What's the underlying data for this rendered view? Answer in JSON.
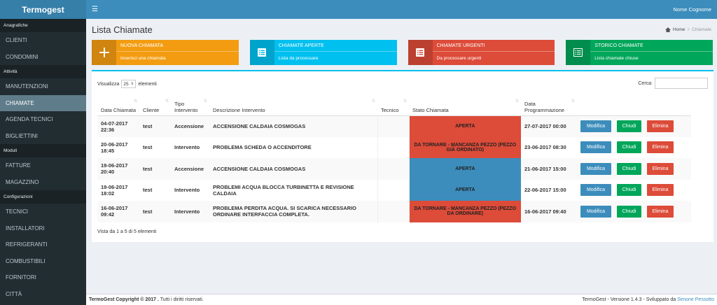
{
  "app": {
    "logo": "Termogest",
    "user": "Nome Cognome"
  },
  "sidebar": {
    "sections": [
      {
        "header": "Anagrafiche",
        "items": [
          "CLIENTI",
          "CONDOMINI"
        ]
      },
      {
        "header": "Attività",
        "items": [
          "MANUTENZIONI",
          "CHIAMATE",
          "AGENDA TECNICI",
          "BIGLIETTINI"
        ]
      },
      {
        "header": "Moduli",
        "items": [
          "FATTURE",
          "MAGAZZINO"
        ]
      },
      {
        "header": "Configurazioni",
        "items": [
          "TECNICI",
          "INSTALLATORI",
          "REFRIGERANTI",
          "COMBUSTIBILI",
          "FORNITORI",
          "CITTÀ"
        ]
      }
    ],
    "active": "CHIAMATE"
  },
  "page": {
    "title": "Lista Chiamate",
    "breadcrumb": {
      "home": "Home",
      "current": "Chiamate"
    }
  },
  "info_boxes": [
    {
      "title": "NUOVA CHIAMATA",
      "subtitle": "Inserisci una chiamata",
      "icon": "plus-icon",
      "color": "#f39c12"
    },
    {
      "title": "CHIAMATE APERTE",
      "subtitle": "Lista da processare",
      "icon": "list-icon",
      "color": "#00c0ef"
    },
    {
      "title": "CHIAMATE URGENTI",
      "subtitle": "Da processare urgenti",
      "icon": "list-icon",
      "color": "#dd4b39"
    },
    {
      "title": "STORICO CHIAMATE",
      "subtitle": "Lista chiamate chiuse",
      "icon": "list-alt-icon",
      "color": "#00a65a"
    }
  ],
  "table_controls": {
    "show_prefix": "Visualizza",
    "page_length": "25",
    "show_suffix": "elementi",
    "search_label": "Cerca:",
    "search_value": ""
  },
  "table": {
    "columns": [
      "Data Chiamata",
      "Cliente",
      "Tipo Intervento",
      "Descrizione Intervento",
      "Tecnico",
      "Stato Chiamata",
      "Data Programmazione",
      ""
    ],
    "rows": [
      {
        "data": "04-07-2017 22:36",
        "cliente": "test",
        "tipo": "Accensione",
        "descrizione": "ACCENSIONE CALDAIA COSMOGAS",
        "tecnico": "",
        "stato": "APERTA",
        "stato_color": "#dd4b39",
        "programmazione": "27-07-2017 00:00"
      },
      {
        "data": "20-06-2017 18:45",
        "cliente": "test",
        "tipo": "Intervento",
        "descrizione": "PROBLEMA SCHEDA O ACCENDITORE",
        "tecnico": "",
        "stato": "DA TORNARE - MANCANZA PEZZO (PEZZO GIÀ ORDINATO)",
        "stato_color": "#dd4b39",
        "programmazione": "23-06-2017 08:30"
      },
      {
        "data": "19-06-2017 20:40",
        "cliente": "test",
        "tipo": "Accensione",
        "descrizione": "ACCENSIONE CALDAIA COSMOGAS",
        "tecnico": "",
        "stato": "APERTA",
        "stato_color": "#3c8dbc",
        "programmazione": "21-06-2017 15:00"
      },
      {
        "data": "19-06-2017 18:02",
        "cliente": "test",
        "tipo": "Intervento",
        "descrizione": "PROBLEMI ACQUA BLOCCA TURBINETTA E REVISIONE CALDAIA",
        "tecnico": "",
        "stato": "APERTA",
        "stato_color": "#3c8dbc",
        "programmazione": "22-06-2017 15:00"
      },
      {
        "data": "16-06-2017 09:42",
        "cliente": "test",
        "tipo": "Intervento",
        "descrizione": "PROBLEMA PERDITA ACQUA. SI SCARICA NECESSARIO ORDINARE INTERFACCIA COMPLETA.",
        "tecnico": "",
        "stato": "DA TORNARE - MANCANZA PEZZO (PEZZO DA ORDINARE)",
        "stato_color": "#dd4b39",
        "programmazione": "16-06-2017 09:40"
      }
    ],
    "actions": {
      "edit": "Modifica",
      "close": "Chiudi",
      "delete": "Elimina"
    },
    "info": "Vista da 1 a 5 di 5 elementi"
  },
  "footer": {
    "copyright": "TermoGest Copyright © 2017 .",
    "rights": "Tutti i diritti riservati.",
    "version": "TermoGest - Versione 1.4.3 - Sviluppato da",
    "author": "Simone Pessotto"
  }
}
